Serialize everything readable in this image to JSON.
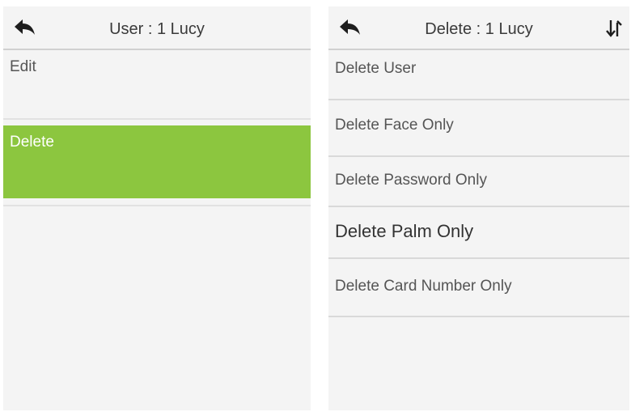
{
  "left_screen": {
    "title": "User : 1 Lucy",
    "icons": {
      "back": "back-arrow-icon"
    },
    "items": [
      {
        "label": "Edit",
        "selected": false
      },
      {
        "label": "Delete",
        "selected": true
      }
    ],
    "colors": {
      "selected_bg": "#8cc63f",
      "background": "#f4f4f4"
    }
  },
  "right_screen": {
    "title": "Delete : 1 Lucy",
    "icons": {
      "back": "back-arrow-icon",
      "sort": "sort-arrows-icon"
    },
    "items": [
      {
        "label": "Delete User"
      },
      {
        "label": "Delete Face Only"
      },
      {
        "label": "Delete Password Only"
      },
      {
        "label": "Delete Palm Only"
      },
      {
        "label": "Delete Card Number Only"
      }
    ]
  }
}
